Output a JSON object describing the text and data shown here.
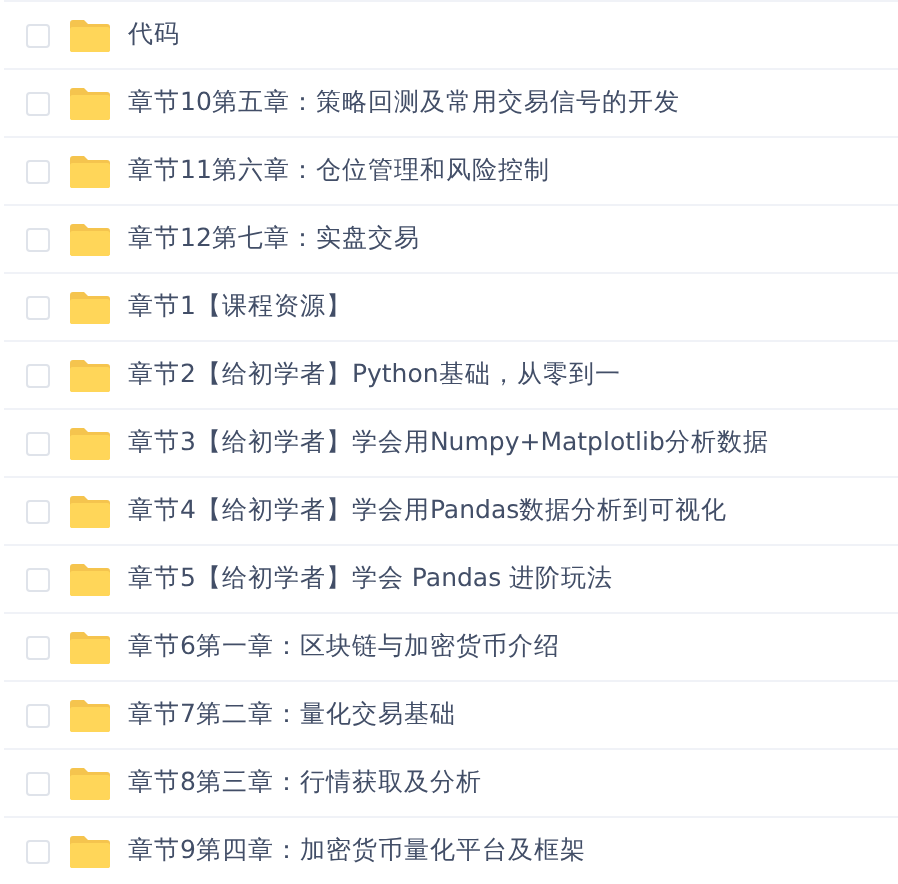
{
  "files": [
    {
      "name": "代码",
      "checked": false
    },
    {
      "name": "章节10第五章：策略回测及常用交易信号的开发",
      "checked": false
    },
    {
      "name": "章节11第六章：仓位管理和风险控制",
      "checked": false
    },
    {
      "name": "章节12第七章：实盘交易",
      "checked": false
    },
    {
      "name": "章节1【课程资源】",
      "checked": false
    },
    {
      "name": "章节2【给初学者】Python基础，从零到一",
      "checked": false
    },
    {
      "name": "章节3【给初学者】学会用Numpy+Matplotlib分析数据",
      "checked": false
    },
    {
      "name": "章节4【给初学者】学会用Pandas数据分析到可视化",
      "checked": false
    },
    {
      "name": "章节5【给初学者】学会 Pandas 进阶玩法",
      "checked": false
    },
    {
      "name": "章节6第一章：区块链与加密货币介绍",
      "checked": false
    },
    {
      "name": "章节7第二章：量化交易基础",
      "checked": false
    },
    {
      "name": "章节8第三章：行情获取及分析",
      "checked": false
    },
    {
      "name": "章节9第四章：加密货币量化平台及框架",
      "checked": false
    }
  ]
}
